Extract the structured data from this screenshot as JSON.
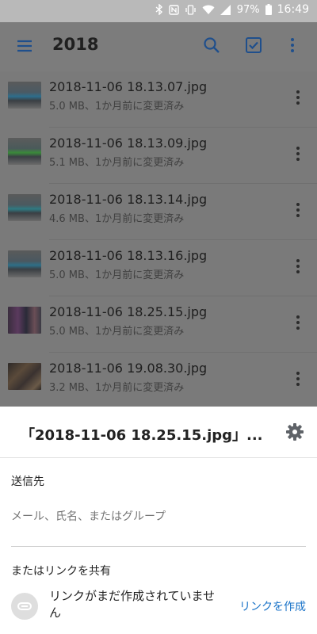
{
  "status_bar": {
    "battery": "97%",
    "time": "16:49"
  },
  "app_bar": {
    "title": "2018",
    "icons": [
      "menu-icon",
      "search-icon",
      "select-icon",
      "more-vert-icon"
    ]
  },
  "files": [
    {
      "name": "2018-11-06 18.13.07.jpg",
      "meta": "5.0 MB、1か月前に変更済み"
    },
    {
      "name": "2018-11-06 18.13.09.jpg",
      "meta": "5.1 MB、1か月前に変更済み"
    },
    {
      "name": "2018-11-06 18.13.14.jpg",
      "meta": "4.6 MB、1か月前に変更済み"
    },
    {
      "name": "2018-11-06 18.13.16.jpg",
      "meta": "5.0 MB、1か月前に変更済み"
    },
    {
      "name": "2018-11-06 18.25.15.jpg",
      "meta": "5.0 MB、1か月前に変更済み"
    },
    {
      "name": "2018-11-06 19.08.30.jpg",
      "meta": "3.2 MB、1か月前に変更済み"
    }
  ],
  "share_sheet": {
    "title": "「2018-11-06 18.25.15.jpg」...",
    "send_to_label": "送信先",
    "recipient_placeholder": "メール、氏名、またはグループ",
    "or_share_link_label": "またはリンクを共有",
    "link_status": "リンクがまだ作成されていません",
    "create_link_label": "リンクを作成"
  },
  "colors": {
    "accent": "#1a73c8",
    "appbar_icon": "#1f4f8c",
    "scrim": "#7a7a7a"
  }
}
